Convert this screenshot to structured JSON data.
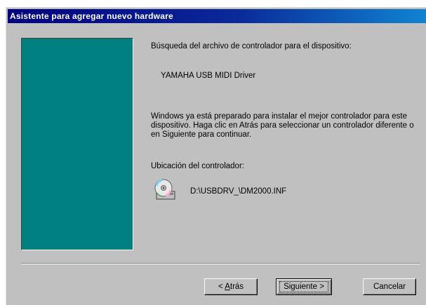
{
  "window": {
    "title": "Asistente para agregar nuevo hardware"
  },
  "content": {
    "search_heading": "Búsqueda del archivo de controlador para el dispositivo:",
    "driver_name": "YAMAHA USB MIDI Driver",
    "explanation": "Windows ya está preparado para instalar el mejor controlador para este dispositivo. Haga clic en Atrás para seleccionar un controlador diferente o en Siguiente para continuar.",
    "location_label": "Ubicación del controlador:",
    "location_path": "D:\\USBDRV_\\DM2000.INF",
    "location_icon": "cd-disc-icon"
  },
  "buttons": {
    "back_prefix": "< ",
    "back_accel": "A",
    "back_rest": "trás",
    "next_label": "Siguiente >",
    "cancel_label": "Cancelar"
  },
  "colors": {
    "title_bar_start": "#000080",
    "title_bar_end": "#1084d0",
    "side_panel": "#008080",
    "dialog_face": "#c0c0c0"
  }
}
